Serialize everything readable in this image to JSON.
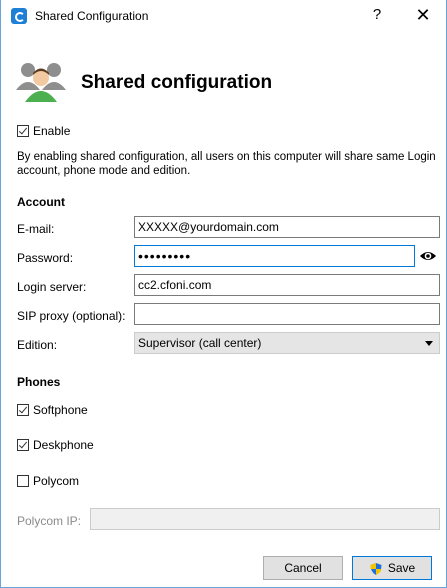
{
  "window": {
    "title": "Shared Configuration",
    "help_glyph": "?",
    "close_glyph": "✕"
  },
  "header": {
    "title": "Shared configuration",
    "icon": "users-icon"
  },
  "enable": {
    "label": "Enable",
    "checked": true
  },
  "description": "By enabling shared configuration, all users on this computer will share same Login account, phone mode and edition.",
  "account": {
    "section_label": "Account",
    "email_label": "E-mail:",
    "email_value": "XXXXX@yourdomain.com",
    "password_label": "Password:",
    "password_value": "•••••••••",
    "login_server_label": "Login server:",
    "login_server_value": "cc2.cfoni.com",
    "sip_proxy_label": "SIP proxy (optional):",
    "sip_proxy_value": "",
    "edition_label": "Edition:",
    "edition_value": "Supervisor (call center)"
  },
  "phones": {
    "section_label": "Phones",
    "softphone_label": "Softphone",
    "softphone_checked": true,
    "deskphone_label": "Deskphone",
    "deskphone_checked": true,
    "polycom_label": "Polycom",
    "polycom_checked": false,
    "polycom_ip_label": "Polycom IP:",
    "polycom_ip_value": ""
  },
  "buttons": {
    "cancel_label": "Cancel",
    "save_label": "Save"
  },
  "colors": {
    "accent": "#0078d7",
    "window_border": "#6aa3d8",
    "disabled_bg": "#f0f0f0"
  }
}
